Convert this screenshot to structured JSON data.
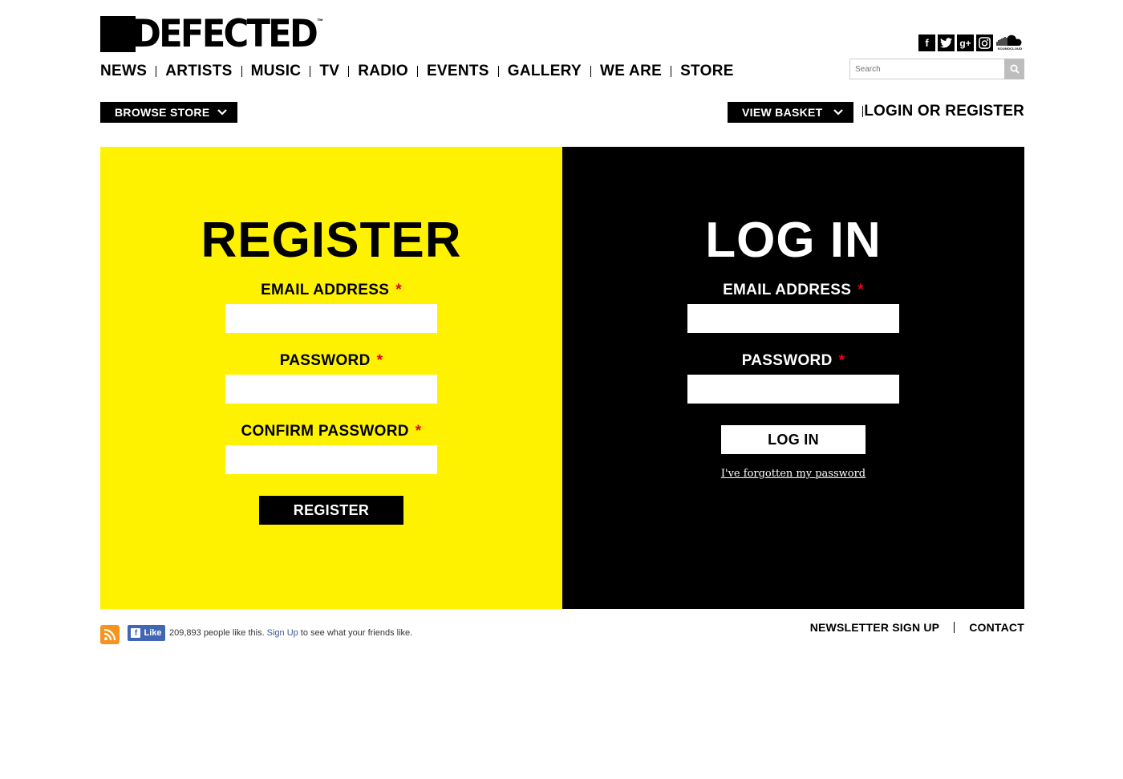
{
  "brand": {
    "logo_text": "DEFECTED",
    "trademark": "™"
  },
  "social": {
    "icons": [
      "facebook-icon",
      "twitter-icon",
      "google-plus-icon",
      "instagram-icon",
      "soundcloud-icon"
    ],
    "soundcloud_label": "SOUNDCLOUD"
  },
  "nav": {
    "items": [
      "NEWS",
      "ARTISTS",
      "MUSIC",
      "TV",
      "RADIO",
      "EVENTS",
      "GALLERY",
      "WE ARE",
      "STORE"
    ]
  },
  "search": {
    "placeholder": "Search"
  },
  "store_bar": {
    "browse_label": "BROWSE STORE",
    "basket_label": "VIEW BASKET",
    "login_register_label": "LOGIN OR REGISTER"
  },
  "register": {
    "title": "REGISTER",
    "email_label": "EMAIL ADDRESS",
    "password_label": "PASSWORD",
    "confirm_label": "CONFIRM PASSWORD",
    "required_mark": "*",
    "email_value": "",
    "password_value": "",
    "confirm_value": "",
    "submit_label": "REGISTER"
  },
  "login": {
    "title": "LOG IN",
    "email_label": "EMAIL ADDRESS",
    "password_label": "PASSWORD",
    "required_mark": "*",
    "email_value": "",
    "password_value": "",
    "submit_label": "LOG IN",
    "forgot_label": "I've forgotten my password"
  },
  "footer": {
    "fb_like_label": "Like",
    "fb_count_text": "209,893 people like this.",
    "fb_signup_label": "Sign Up",
    "fb_tail_text": "to see what your friends like.",
    "newsletter_label": "NEWSLETTER SIGN UP",
    "contact_label": "CONTACT"
  },
  "colors": {
    "yellow": "#fff200",
    "black": "#000000",
    "required": "#e2001a",
    "facebook": "#4267b2",
    "rss": "#f7941d"
  }
}
